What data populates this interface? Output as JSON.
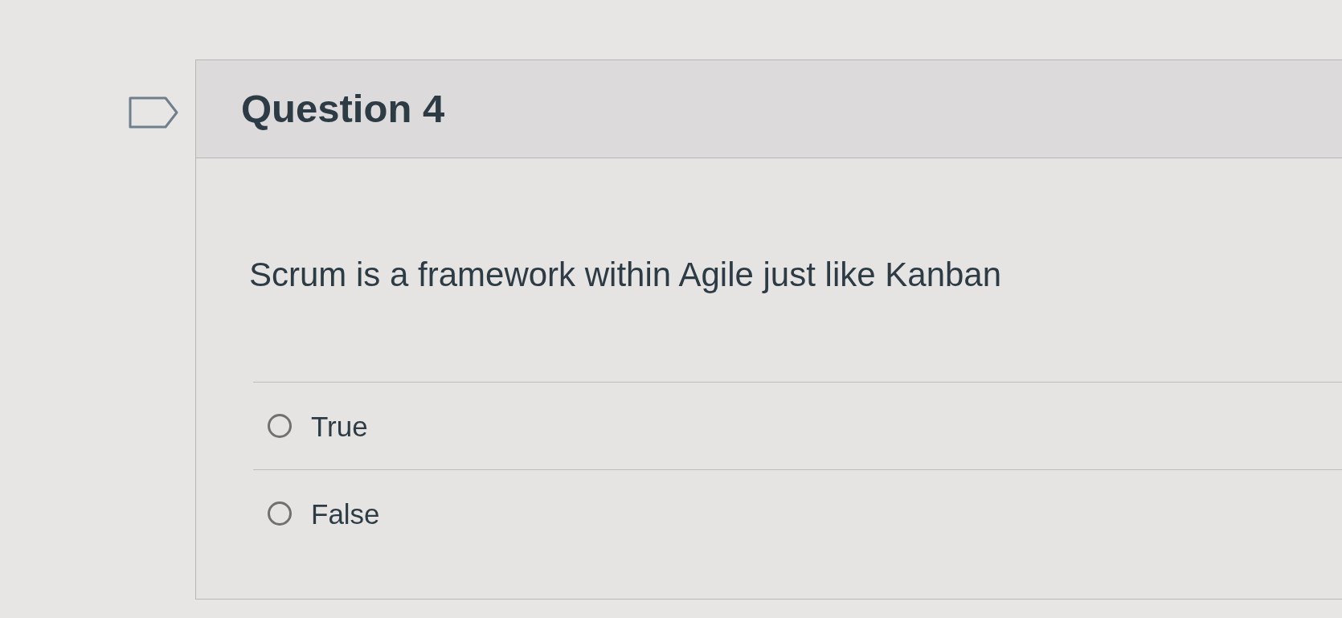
{
  "question": {
    "flagged": false,
    "title": "Question 4",
    "text": "Scrum is a framework within Agile just like Kanban",
    "options": [
      {
        "label": "True",
        "selected": false
      },
      {
        "label": "False",
        "selected": false
      }
    ]
  }
}
